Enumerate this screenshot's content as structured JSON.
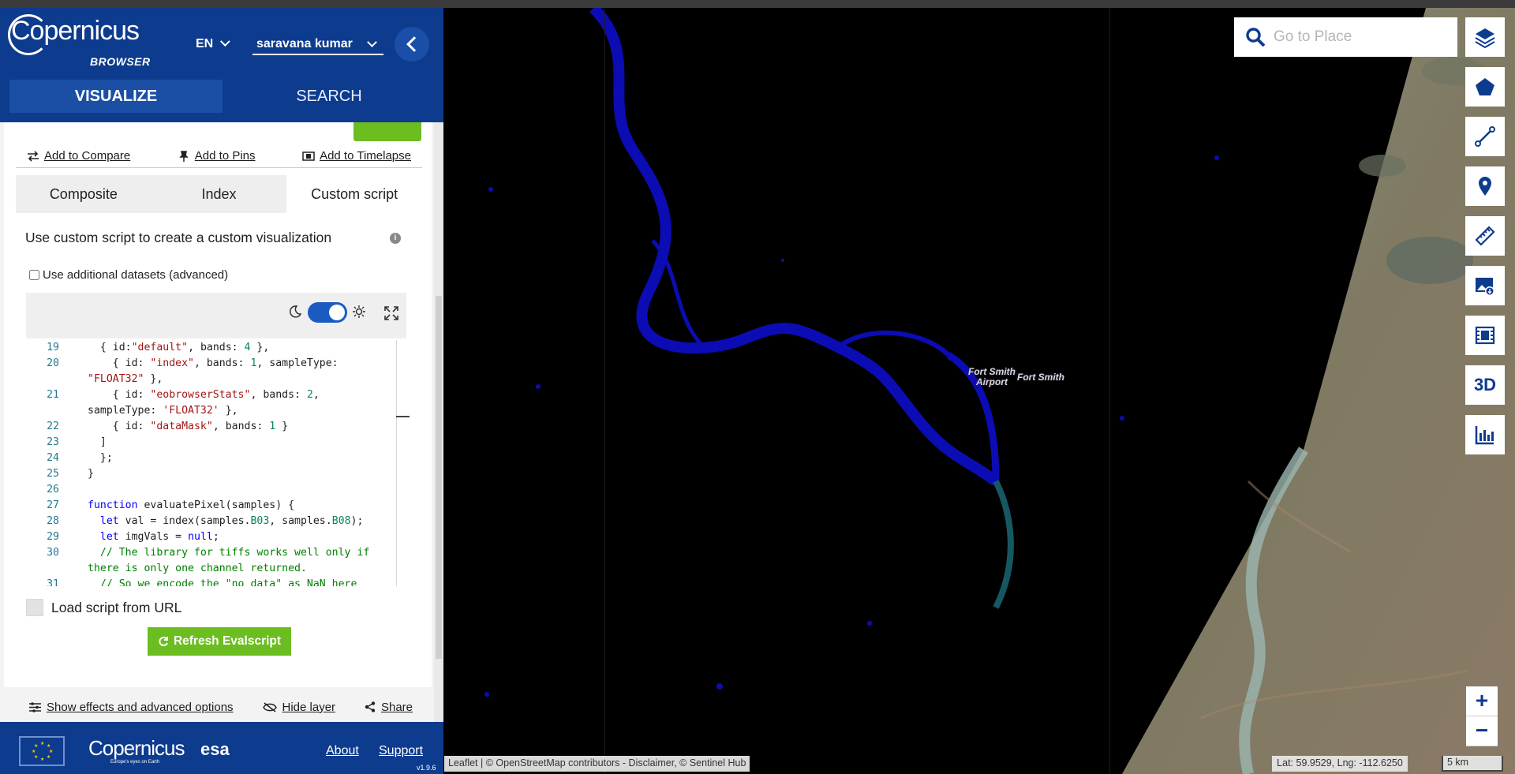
{
  "header": {
    "logo_text": "Copernicus",
    "logo_sub": "BROWSER",
    "language": "EN",
    "user": "saravana kumar",
    "tabs": [
      {
        "label": "VISUALIZE",
        "active": true
      },
      {
        "label": "SEARCH",
        "active": false
      }
    ]
  },
  "actions": {
    "compare": "Add to Compare",
    "pins": "Add to Pins",
    "timelapse": "Add to Timelapse"
  },
  "subtabs": [
    {
      "label": "Composite",
      "selected": false
    },
    {
      "label": "Index",
      "selected": false
    },
    {
      "label": "Custom script",
      "selected": true
    }
  ],
  "custom": {
    "description": "Use custom script to create a custom visualization",
    "additional_datasets": "Use additional datasets (advanced)",
    "load_from_url": "Load script from URL",
    "refresh_button": "Refresh Evalscript"
  },
  "code_lines": [
    {
      "n": "19",
      "indent": "  ",
      "tokens": [
        [
          "p",
          "{ id:"
        ],
        [
          "s",
          "\"default\""
        ],
        [
          "p",
          ", bands: "
        ],
        [
          "n",
          "4"
        ],
        [
          "p",
          " },"
        ]
      ]
    },
    {
      "n": "20",
      "indent": "    ",
      "tokens": [
        [
          "p",
          "{ id: "
        ],
        [
          "s",
          "\"index\""
        ],
        [
          "p",
          ", bands: "
        ],
        [
          "n",
          "1"
        ],
        [
          "p",
          ", sampleType:"
        ]
      ]
    },
    {
      "n": "",
      "indent": "",
      "tokens": [
        [
          "s",
          "\"FLOAT32\""
        ],
        [
          "p",
          " },"
        ]
      ]
    },
    {
      "n": "21",
      "indent": "    ",
      "tokens": [
        [
          "p",
          "{ id: "
        ],
        [
          "s",
          "\"eobrowserStats\""
        ],
        [
          "p",
          ", bands: "
        ],
        [
          "n",
          "2"
        ],
        [
          "p",
          ","
        ]
      ]
    },
    {
      "n": "",
      "indent": "",
      "tokens": [
        [
          "p",
          "sampleType: "
        ],
        [
          "s",
          "'FLOAT32'"
        ],
        [
          "p",
          " },"
        ]
      ]
    },
    {
      "n": "22",
      "indent": "    ",
      "tokens": [
        [
          "p",
          "{ id: "
        ],
        [
          "s",
          "\"dataMask\""
        ],
        [
          "p",
          ", bands: "
        ],
        [
          "n",
          "1"
        ],
        [
          "p",
          " }"
        ]
      ]
    },
    {
      "n": "23",
      "indent": "  ",
      "tokens": [
        [
          "p",
          "]"
        ]
      ]
    },
    {
      "n": "24",
      "indent": "  ",
      "tokens": [
        [
          "p",
          "};"
        ]
      ]
    },
    {
      "n": "25",
      "indent": "",
      "tokens": [
        [
          "p",
          "}"
        ]
      ]
    },
    {
      "n": "26",
      "indent": "",
      "tokens": []
    },
    {
      "n": "27",
      "indent": "",
      "tokens": [
        [
          "k",
          "function"
        ],
        [
          "p",
          " evaluatePixel(samples) {"
        ]
      ]
    },
    {
      "n": "28",
      "indent": "  ",
      "tokens": [
        [
          "k",
          "let"
        ],
        [
          "p",
          " val = index(samples."
        ],
        [
          "n",
          "B03"
        ],
        [
          "p",
          ", samples."
        ],
        [
          "n",
          "B08"
        ],
        [
          "p",
          ");"
        ]
      ]
    },
    {
      "n": "29",
      "indent": "  ",
      "tokens": [
        [
          "k",
          "let"
        ],
        [
          "p",
          " imgVals = "
        ],
        [
          "k",
          "null"
        ],
        [
          "p",
          ";"
        ]
      ]
    },
    {
      "n": "30",
      "indent": "  ",
      "tokens": [
        [
          "c",
          "// The library for tiffs works well only if"
        ]
      ]
    },
    {
      "n": "",
      "indent": "",
      "tokens": [
        [
          "c",
          "there is only one channel returned."
        ]
      ]
    },
    {
      "n": "31",
      "indent": "  ",
      "tokens": [
        [
          "c",
          "// So we encode the \"no data\" as NaN here"
        ]
      ]
    }
  ],
  "bottom_actions": {
    "effects": "Show effects and advanced options",
    "hide": "Hide layer",
    "share": "Share"
  },
  "footer": {
    "logo_text": "Copernicus",
    "tagline": "Europe's eyes on Earth",
    "esa": "esa",
    "about": "About",
    "support": "Support",
    "version": "v1.9.6"
  },
  "map": {
    "search_placeholder": "Go to Place",
    "place_airport": "Fort Smith Airport",
    "place_city": "Fort Smith",
    "attribution": "Leaflet | © OpenStreetMap contributors - Disclaimer, © Sentinel Hub",
    "coordinates": "Lat: 59.9529, Lng: -112.6250",
    "scale": "5 km",
    "zoom_in": "+",
    "zoom_out": "−",
    "tool_3d": "3D",
    "tools": [
      "layers-icon",
      "polygon-icon",
      "line-icon",
      "pin-icon",
      "ruler-icon",
      "image-download-icon",
      "timelapse-icon",
      "3d-icon",
      "chart-icon"
    ]
  },
  "colors": {
    "brand_blue": "#0d3b8e",
    "accent_green": "#6bbd20",
    "water_blue": "#1010c8"
  }
}
